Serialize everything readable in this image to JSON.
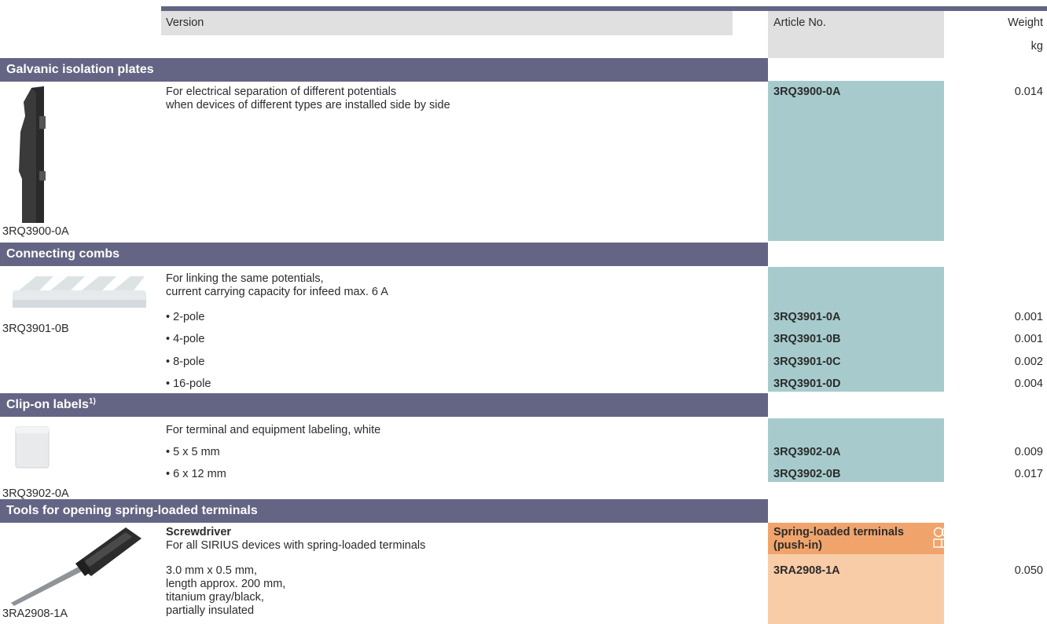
{
  "header": {
    "version_label": "Version",
    "article_label": "Article No.",
    "weight_label": "Weight",
    "weight_unit": "kg"
  },
  "sections": {
    "galvanic": {
      "title": "Galvanic isolation plates",
      "image_caption": "3RQ3900-0A",
      "desc_line1": "For electrical separation of different potentials",
      "desc_line2": "when devices of different types are installed side by side",
      "article": "3RQ3900-0A",
      "weight": "0.014"
    },
    "combs": {
      "title": "Connecting combs",
      "image_caption": "3RQ3901-0B",
      "desc_line1": "For linking the same potentials,",
      "desc_line2": "current carrying capacity for infeed max. 6 A",
      "items": [
        {
          "label": "• 2-pole",
          "article": "3RQ3901-0A",
          "weight": "0.001"
        },
        {
          "label": "• 4-pole",
          "article": "3RQ3901-0B",
          "weight": "0.001"
        },
        {
          "label": "• 8-pole",
          "article": "3RQ3901-0C",
          "weight": "0.002"
        },
        {
          "label": "• 16-pole",
          "article": "3RQ3901-0D",
          "weight": "0.004"
        }
      ]
    },
    "labels": {
      "title": "Clip-on labels",
      "footnote": "1)",
      "image_caption": "3RQ3902-0A",
      "desc_line1": "For terminal and equipment labeling, white",
      "items": [
        {
          "label": "• 5 x 5 mm",
          "article": "3RQ3902-0A",
          "weight": "0.009"
        },
        {
          "label": "• 6 x 12 mm",
          "article": "3RQ3902-0B",
          "weight": "0.017"
        }
      ]
    },
    "tools": {
      "title": "Tools for opening spring-loaded terminals",
      "image_caption": "3RA2908-1A",
      "item_title": "Screwdriver",
      "desc_line1": "For all SIRIUS devices with spring-loaded terminals",
      "spec_lines": [
        "3.0 mm x 0.5 mm,",
        "length approx. 200 mm,",
        "titanium gray/black,",
        "partially insulated"
      ],
      "terminal_type_line1": "Spring-loaded terminals",
      "terminal_type_line2": "(push-in)",
      "article": "3RA2908-1A",
      "weight": "0.050"
    }
  },
  "colors": {
    "band": "#646484",
    "article_bg": "#a7cbcc",
    "spring_header_bg": "#f0a46c",
    "spring_body_bg": "#f8cca6",
    "header_bar": "#e0e0e0"
  }
}
